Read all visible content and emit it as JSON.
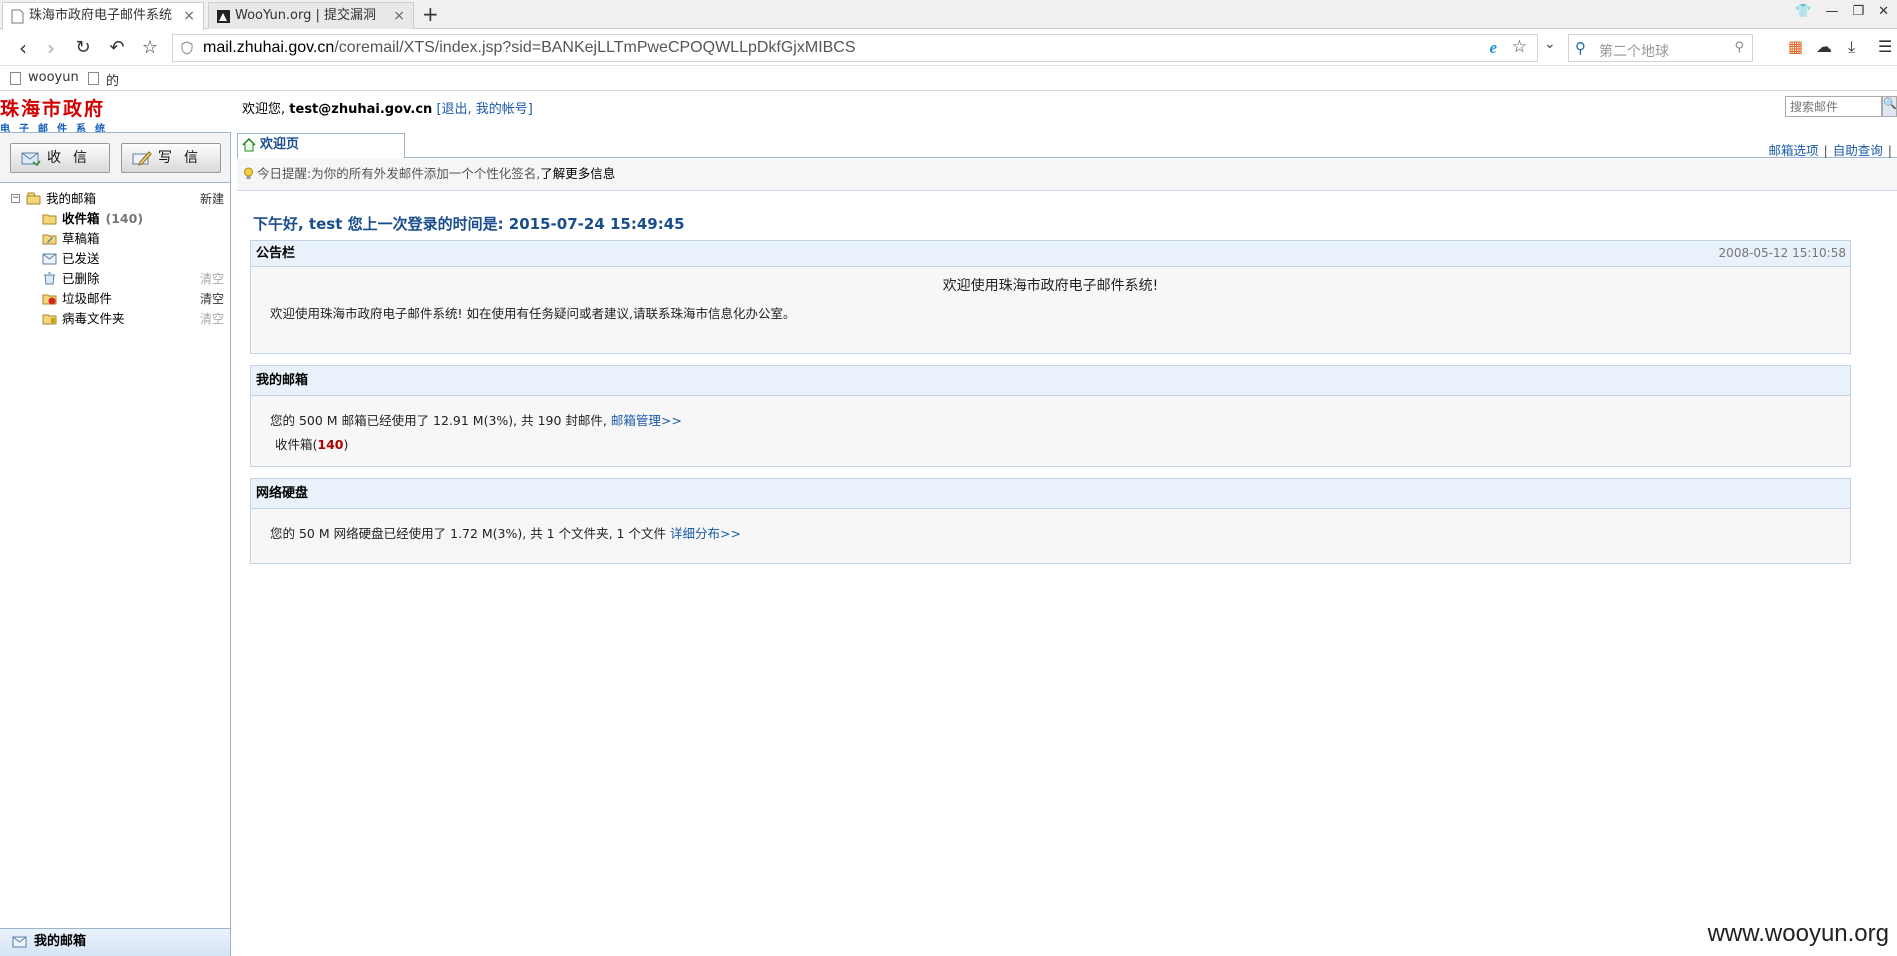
{
  "browser": {
    "tabs": [
      {
        "title": "珠海市政府电子邮件系统",
        "close": "×"
      },
      {
        "title": "WooYun.org | 提交漏洞",
        "close": "×"
      }
    ],
    "new_tab": "+",
    "url_host": "mail.zhuhai.gov.cn",
    "url_path": "/coremail/XTS/index.jsp?sid=BANKejLLTmPweCPOQWLLpDkfGjxMIBCS",
    "search_placeholder": "第二个地球",
    "bookmarks": [
      "wooyun",
      "的"
    ]
  },
  "app": {
    "logo_main": "珠海市政府",
    "logo_sub": "电子邮件系统",
    "welcome_prefix": "欢迎您,",
    "user_email": "test@zhuhai.gov.cn",
    "welcome_links": "[退出, 我的帐号]",
    "search_placeholder": "搜索邮件",
    "receive_label": "收信",
    "compose_label": "写信"
  },
  "folders": {
    "root": "我的邮箱",
    "root_action": "新建",
    "items": [
      {
        "name": "收件箱",
        "count": "(140)",
        "action": ""
      },
      {
        "name": "草稿箱",
        "count": "",
        "action": ""
      },
      {
        "name": "已发送",
        "count": "",
        "action": ""
      },
      {
        "name": "已删除",
        "count": "",
        "action": "清空"
      },
      {
        "name": "垃圾邮件",
        "count": "",
        "action": "清空"
      },
      {
        "name": "病毒文件夹",
        "count": "",
        "action": "清空"
      }
    ],
    "footer": "我的邮箱"
  },
  "main": {
    "tab_label": "欢迎页",
    "top_links": [
      "邮箱选项",
      "自助查询"
    ],
    "tip_text": "今日提醒:为你的所有外发邮件添加一个个性化签名,",
    "tip_link": "了解更多信息",
    "greeting": "下午好, test 您上一次登录的时间是: 2015-07-24 15:49:45"
  },
  "announcement": {
    "title": "公告栏",
    "date": "2008-05-12 15:10:58",
    "headline": "欢迎使用珠海市政府电子邮件系统!",
    "text": "欢迎使用珠海市政府电子邮件系统! 如在使用有任务疑问或者建议,请联系珠海市信息化办公室。"
  },
  "mailbox": {
    "title": "我的邮箱",
    "usage": "您的 500 M 邮箱已经使用了 12.91 M(3%), 共 190 封邮件,",
    "manage_link": "邮箱管理>>",
    "inbox_label": "收件箱(",
    "inbox_count": "140",
    "inbox_close": ")"
  },
  "disk": {
    "title": "网络硬盘",
    "usage": "您的 50 M 网络硬盘已经使用了 1.72 M(3%), 共 1 个文件夹, 1 个文件",
    "detail_link": "详细分布>>"
  },
  "watermark": "www.wooyun.org"
}
